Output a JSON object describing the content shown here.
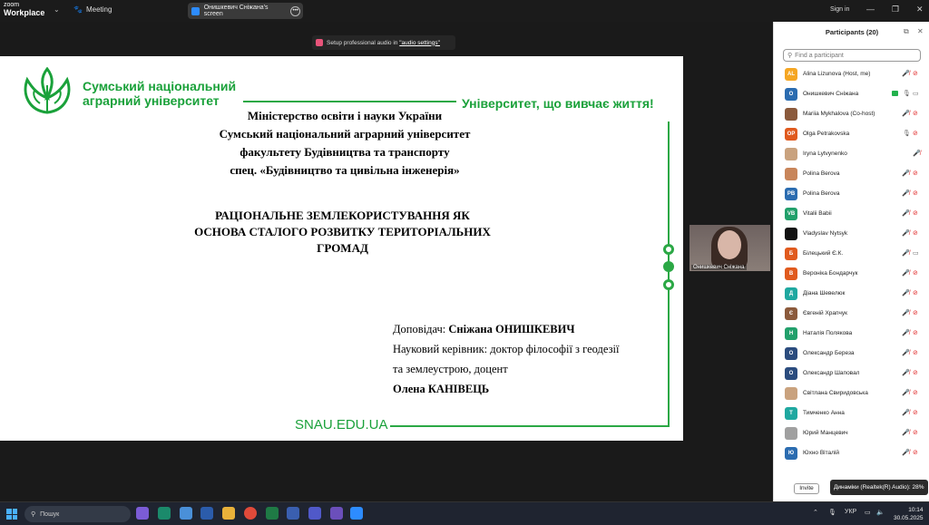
{
  "titlebar": {
    "app_line1": "zoom",
    "app_line2": "Workplace",
    "meeting_label": "Meeting",
    "share_label": "Онишкевич Сніжана's screen",
    "signin": "Sign in"
  },
  "audio_bar": {
    "prefix": "Setup professional audio in ",
    "link": "\"audio settings\""
  },
  "slide": {
    "university": [
      "Сумський національний",
      "аграрний університет"
    ],
    "motto": "Університет, що вивчає життя!",
    "ministry": [
      "Міністерство освіти і науки України",
      "Сумський національний аграрний університет",
      "факультету Будівництва та транспорту",
      "спец. «Будівництво та цивільна інженерія»"
    ],
    "topic": [
      "РАЦІОНАЛЬНЕ ЗЕМЛЕКОРИСТУВАННЯ ЯК",
      "ОСНОВА СТАЛОГО РОЗВИТКУ ТЕРИТОРІАЛЬНИХ",
      "ГРОМАД"
    ],
    "speaker_label": "Доповідач: ",
    "speaker_name": "Сніжана ОНИШКЕВИЧ",
    "supervisor_line1": "Науковий керівник: доктор філософії з геодезії",
    "supervisor_line2": "та землеустрою, доцент",
    "supervisor_name": "Олена КАНІВЕЦЬ",
    "site": "SNAU.EDU.UA"
  },
  "camera": {
    "label": "Онишкевич Сніжана"
  },
  "participants": {
    "title": "Participants (20)",
    "search_placeholder": "Find a participant",
    "list": [
      {
        "initials": "AL",
        "color": "#f5a623",
        "name": "Alina Lizunova (Host, me)",
        "state": "muted"
      },
      {
        "initials": "О",
        "color": "#2b6cb0",
        "name": "Онишкевич Сніжана",
        "state": "sharing"
      },
      {
        "initials": "",
        "color": "#8b5a3c",
        "name": "Mariia Mykhalova (Co-host)",
        "state": "muted"
      },
      {
        "initials": "OP",
        "color": "#e05a1e",
        "name": "Olga Petrakovska",
        "state": "mic"
      },
      {
        "initials": "",
        "color": "#c9a27e",
        "name": "Iryna Lytvynenko",
        "state": "muted-only"
      },
      {
        "initials": "",
        "color": "#c8855a",
        "name": "Polina Berova",
        "state": "muted"
      },
      {
        "initials": "PB",
        "color": "#2b6cb0",
        "name": "Polina Berova",
        "state": "muted"
      },
      {
        "initials": "VB",
        "color": "#22a06b",
        "name": "Vitalii Babii",
        "state": "muted"
      },
      {
        "initials": "",
        "color": "#111111",
        "name": "Vladyslav Nytsyk",
        "state": "muted"
      },
      {
        "initials": "Б",
        "color": "#e05a1e",
        "name": "Білецький Є.К.",
        "state": "muted-cam"
      },
      {
        "initials": "В",
        "color": "#e05a1e",
        "name": "Вероніка Бондарчук",
        "state": "muted"
      },
      {
        "initials": "Д",
        "color": "#1fa8a0",
        "name": "Діана Шевелюк",
        "state": "muted"
      },
      {
        "initials": "Є",
        "color": "#8b5a3c",
        "name": "Євгеній Храпчук",
        "state": "muted"
      },
      {
        "initials": "Н",
        "color": "#22a06b",
        "name": "Наталія Полякова",
        "state": "muted"
      },
      {
        "initials": "О",
        "color": "#2b4c7e",
        "name": "Олександр Береза",
        "state": "muted"
      },
      {
        "initials": "О",
        "color": "#2b4c7e",
        "name": "Олександр Шаповал",
        "state": "muted"
      },
      {
        "initials": "",
        "color": "#c9a27e",
        "name": "Світлана Свиридовська",
        "state": "muted"
      },
      {
        "initials": "Т",
        "color": "#1fa8a0",
        "name": "Тимченко Анна",
        "state": "muted"
      },
      {
        "initials": "",
        "color": "#a0a0a0",
        "name": "Юрий Манцевич",
        "state": "muted"
      },
      {
        "initials": "Ю",
        "color": "#2b6cb0",
        "name": "Юхно Віталій",
        "state": "muted"
      }
    ],
    "invite": "Invite",
    "tooltip": "Динаміки (Realtek(R) Audio): 28%"
  },
  "taskbar": {
    "search": "Пошук",
    "lang": "УКР",
    "time": "10:14",
    "date": "30.05.2025"
  }
}
